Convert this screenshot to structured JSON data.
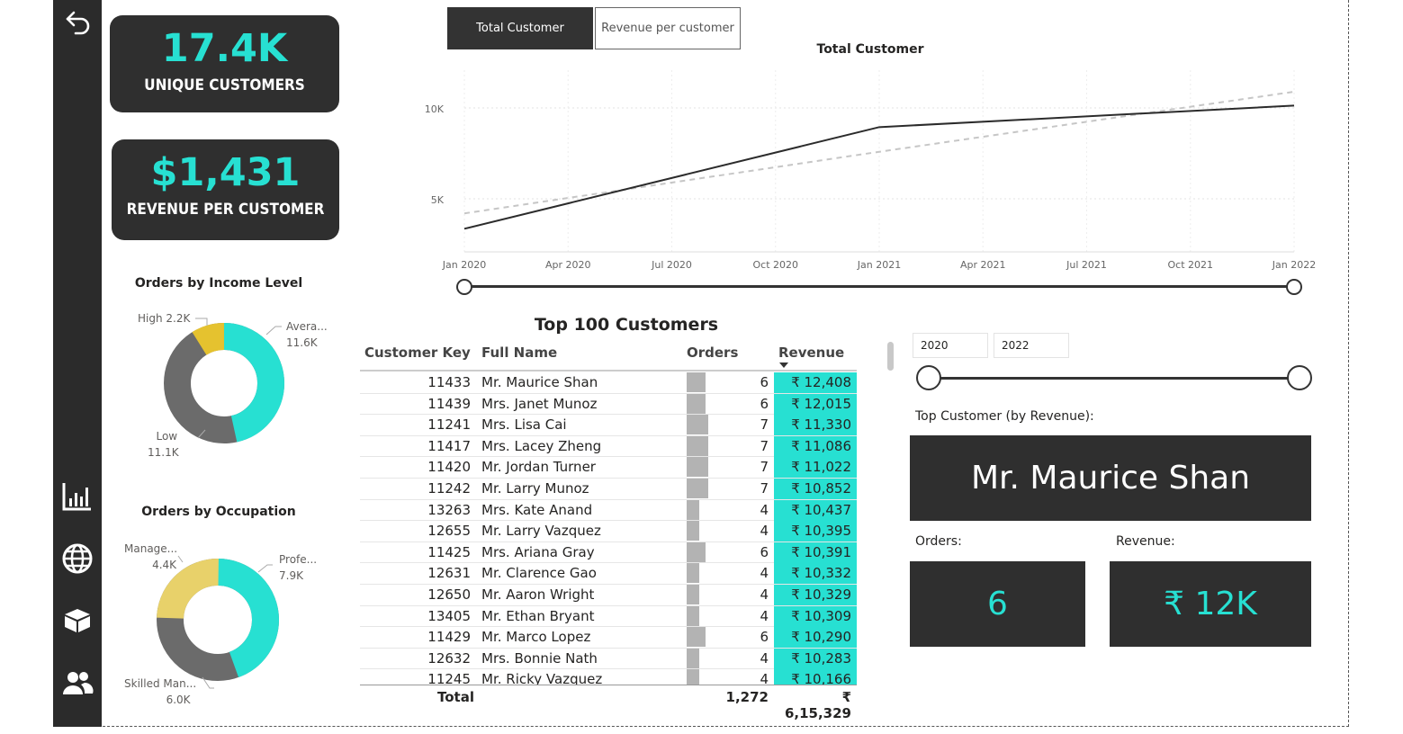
{
  "kpis": {
    "unique_customers": {
      "value": "17.4K",
      "label": "UNIQUE CUSTOMERS"
    },
    "revenue_per_customer": {
      "value": "$1,431",
      "label": "REVENUE PER CUSTOMER"
    }
  },
  "sidebar": {
    "icons": [
      "back-arrow-icon",
      "bar-chart-icon",
      "globe-icon",
      "box-icon",
      "people-icon"
    ]
  },
  "income_donut": {
    "title": "Orders by Income Level",
    "labels": {
      "high": {
        "name": "High",
        "value": "2.2K"
      },
      "average": {
        "name": "Avera...",
        "value": "11.6K"
      },
      "low": {
        "name": "Low",
        "value": "11.1K"
      }
    }
  },
  "occupation_donut": {
    "title": "Orders by Occupation",
    "labels": {
      "management": {
        "name": "Manage...",
        "value": "4.4K"
      },
      "professional": {
        "name": "Profe...",
        "value": "7.9K"
      },
      "skilled": {
        "name": "Skilled Man...",
        "value": "6.0K"
      }
    }
  },
  "toggle": {
    "total_customer": "Total Customer",
    "revenue_per_customer": "Revenue per customer"
  },
  "line_chart": {
    "title": "Total Customer",
    "y_ticks": [
      "10K",
      "5K"
    ],
    "x_ticks": [
      "Jan 2020",
      "Apr 2020",
      "Jul 2020",
      "Oct 2020",
      "Jan 2021",
      "Apr 2021",
      "Jul 2021",
      "Oct 2021",
      "Jan 2022"
    ]
  },
  "chart_data": {
    "type": "line",
    "title": "Total Customer",
    "x": [
      "Jan 2020",
      "Jan 2021",
      "Jan 2022"
    ],
    "series": [
      {
        "values": [
          2500,
          9100,
          10500
        ]
      },
      {
        "values": [
          3500,
          7500,
          11400
        ]
      }
    ],
    "ylim": [
      1000,
      12800
    ],
    "grid": true
  },
  "table": {
    "title": "Top 100 Customers",
    "columns": [
      "Customer Key",
      "Full Name",
      "Orders",
      "Revenue"
    ],
    "rows": [
      {
        "key": "11433",
        "name": "Mr. Maurice Shan",
        "orders": "6",
        "revenue": "₹ 12,408"
      },
      {
        "key": "11439",
        "name": "Mrs. Janet Munoz",
        "orders": "6",
        "revenue": "₹ 12,015"
      },
      {
        "key": "11241",
        "name": "Mrs. Lisa Cai",
        "orders": "7",
        "revenue": "₹ 11,330"
      },
      {
        "key": "11417",
        "name": "Mrs. Lacey Zheng",
        "orders": "7",
        "revenue": "₹ 11,086"
      },
      {
        "key": "11420",
        "name": "Mr. Jordan Turner",
        "orders": "7",
        "revenue": "₹ 11,022"
      },
      {
        "key": "11242",
        "name": "Mr. Larry Munoz",
        "orders": "7",
        "revenue": "₹ 10,852"
      },
      {
        "key": "13263",
        "name": "Mrs. Kate Anand",
        "orders": "4",
        "revenue": "₹ 10,437"
      },
      {
        "key": "12655",
        "name": "Mr. Larry Vazquez",
        "orders": "4",
        "revenue": "₹ 10,395"
      },
      {
        "key": "11425",
        "name": "Mrs. Ariana Gray",
        "orders": "6",
        "revenue": "₹ 10,391"
      },
      {
        "key": "12631",
        "name": "Mr. Clarence Gao",
        "orders": "4",
        "revenue": "₹ 10,332"
      },
      {
        "key": "12650",
        "name": "Mr. Aaron Wright",
        "orders": "4",
        "revenue": "₹ 10,329"
      },
      {
        "key": "13405",
        "name": "Mr. Ethan Bryant",
        "orders": "4",
        "revenue": "₹ 10,309"
      },
      {
        "key": "11429",
        "name": "Mr. Marco Lopez",
        "orders": "6",
        "revenue": "₹ 10,290"
      },
      {
        "key": "12632",
        "name": "Mrs. Bonnie Nath",
        "orders": "4",
        "revenue": "₹ 10,283"
      },
      {
        "key": "11245",
        "name": "Mr. Ricky Vazquez",
        "orders": "4",
        "revenue": "₹ 10,166"
      }
    ],
    "total": {
      "label": "Total",
      "orders": "1,272",
      "revenue": "₹ 6,15,329"
    }
  },
  "year_slicer": {
    "start": "2020",
    "end": "2022"
  },
  "top_customer": {
    "label": "Top Customer (by Revenue):",
    "name": "Mr. Maurice Shan",
    "orders_label": "Orders:",
    "orders_value": "6",
    "revenue_label": "Revenue:",
    "revenue_value": "₹ 12K"
  },
  "colors": {
    "accent": "#27e0d2",
    "dark": "#2f2f2f",
    "gold": "#e5c22f",
    "gray": "#6b6b6b",
    "light_gold": "#e8d16a"
  }
}
